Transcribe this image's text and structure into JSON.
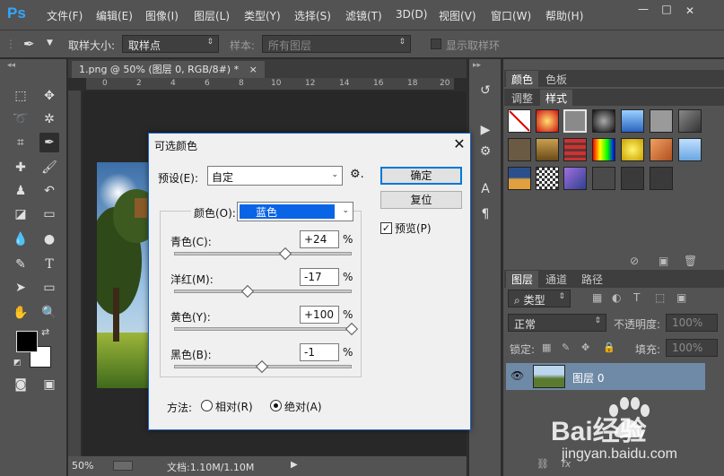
{
  "app": {
    "logo": "Ps"
  },
  "menu": {
    "items": [
      "文件(F)",
      "编辑(E)",
      "图像(I)",
      "图层(L)",
      "类型(Y)",
      "选择(S)",
      "滤镜(T)",
      "3D(D)",
      "视图(V)",
      "窗口(W)",
      "帮助(H)"
    ],
    "window_buttons": [
      "—",
      "□",
      "✕"
    ]
  },
  "options_bar": {
    "sample_size_label": "取样大小:",
    "sample_size_value": "取样点",
    "sample_label": "样本:",
    "sample_value": "所有图层",
    "show_ring_label": "显示取样环"
  },
  "document": {
    "tab_title": "1.png @ 50% (图层 0, RGB/8#) *",
    "tab_close": "×",
    "ruler_ticks": [
      "0",
      "2",
      "4",
      "6",
      "8",
      "10",
      "12",
      "14",
      "16",
      "18",
      "20"
    ],
    "zoom": "50%",
    "doc_size": "文档:1.10M/1.10M"
  },
  "panels": {
    "color_tabs": [
      "颜色",
      "色板"
    ],
    "adjust_tabs": [
      "调整",
      "样式"
    ],
    "layer_tabs": [
      "图层",
      "通道",
      "路径"
    ],
    "kind_filter": "类型",
    "blend_mode": "正常",
    "opacity_label": "不透明度:",
    "opacity_value": "100%",
    "lock_label": "锁定:",
    "fill_label": "填充:",
    "fill_value": "100%",
    "layer_name": "图层 0"
  },
  "dialog": {
    "title": "可选颜色",
    "preset_label": "预设(E):",
    "preset_value": "自定",
    "ok_label": "确定",
    "reset_label": "复位",
    "preview_label": "预览(P)",
    "preview_checked": true,
    "colors_label": "颜色(O):",
    "colors_value": "蓝色",
    "colors_swatch": "#0a64e6",
    "sliders": [
      {
        "label": "青色(C):",
        "value": "+24",
        "unit": "%"
      },
      {
        "label": "洋红(M):",
        "value": "-17",
        "unit": "%"
      },
      {
        "label": "黄色(Y):",
        "value": "+100",
        "unit": "%"
      },
      {
        "label": "黑色(B):",
        "value": "-1",
        "unit": "%"
      }
    ],
    "method_label": "方法:",
    "relative_label": "相对(R)",
    "absolute_label": "绝对(A)",
    "method_selected": "absolute"
  },
  "watermark": {
    "brand": "Bai经验",
    "url": "jingyan.baidu.com"
  },
  "colors": {
    "ui_dark": "#535353",
    "canvas": "#282828",
    "accent": "#0078d7",
    "foreground": "#000000",
    "background": "#ffffff"
  }
}
